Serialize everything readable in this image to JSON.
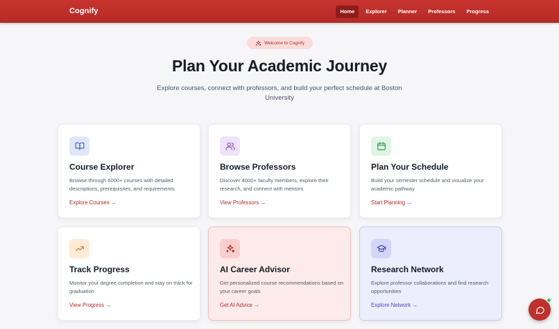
{
  "app": {
    "brand": "Cognify"
  },
  "nav": {
    "items": [
      {
        "label": "Home",
        "active": true
      },
      {
        "label": "Explorer"
      },
      {
        "label": "Planner"
      },
      {
        "label": "Professors"
      },
      {
        "label": "Progress"
      }
    ]
  },
  "hero": {
    "badge": "Welcome to Cognify",
    "badge_icon": "sparkles-icon",
    "title": "Plan Your Academic Journey",
    "subtitle": "Explore courses, connect with professors, and build your perfect schedule at Boston University"
  },
  "cards": [
    {
      "icon": "book-open-icon",
      "title": "Course Explorer",
      "description": "Browse through 6000+ courses with detailed descriptions, prerequisites, and requirements",
      "link": "Explore Courses →",
      "icon_bg": "#e0e7fb",
      "icon_color": "#3b63c7"
    },
    {
      "icon": "users-icon",
      "title": "Browse Professors",
      "description": "Discover 4000+ faculty members, explore their research, and connect with mentors",
      "link": "View Professors →",
      "icon_bg": "#efe3fb",
      "icon_color": "#8a4fcf"
    },
    {
      "icon": "calendar-icon",
      "title": "Plan Your Schedule",
      "description": "Build your semester schedule and visualize your academic pathway",
      "link": "Start Planning →",
      "icon_bg": "#dff5e6",
      "icon_color": "#2b9a52"
    },
    {
      "icon": "trending-up-icon",
      "title": "Track Progress",
      "description": "Monitor your degree completion and stay on track for graduation",
      "link": "View Progress →",
      "icon_bg": "#fdebd6",
      "icon_color": "#dc7b1f"
    },
    {
      "icon": "sparkles-icon",
      "title": "AI Career Advisor",
      "description": "Get personalized course recommendations based on your career goals",
      "link": "Get AI Advice →",
      "icon_bg": "#f8cfcc",
      "icon_color": "#b52a26"
    },
    {
      "icon": "graduation-cap-icon",
      "title": "Research Network",
      "description": "Explore professor collaborations and find research opportunities",
      "link": "Explore Network →",
      "icon_bg": "#d3d6fa",
      "icon_color": "#4343a8"
    }
  ],
  "chat": {
    "icon": "chat-bubble-icon"
  },
  "colors": {
    "brand": "#c0302c",
    "nav_active": "#8e1d1a",
    "link": "#b52a26",
    "link_blue": "#4b4bb0",
    "online": "#2fbf5b"
  }
}
